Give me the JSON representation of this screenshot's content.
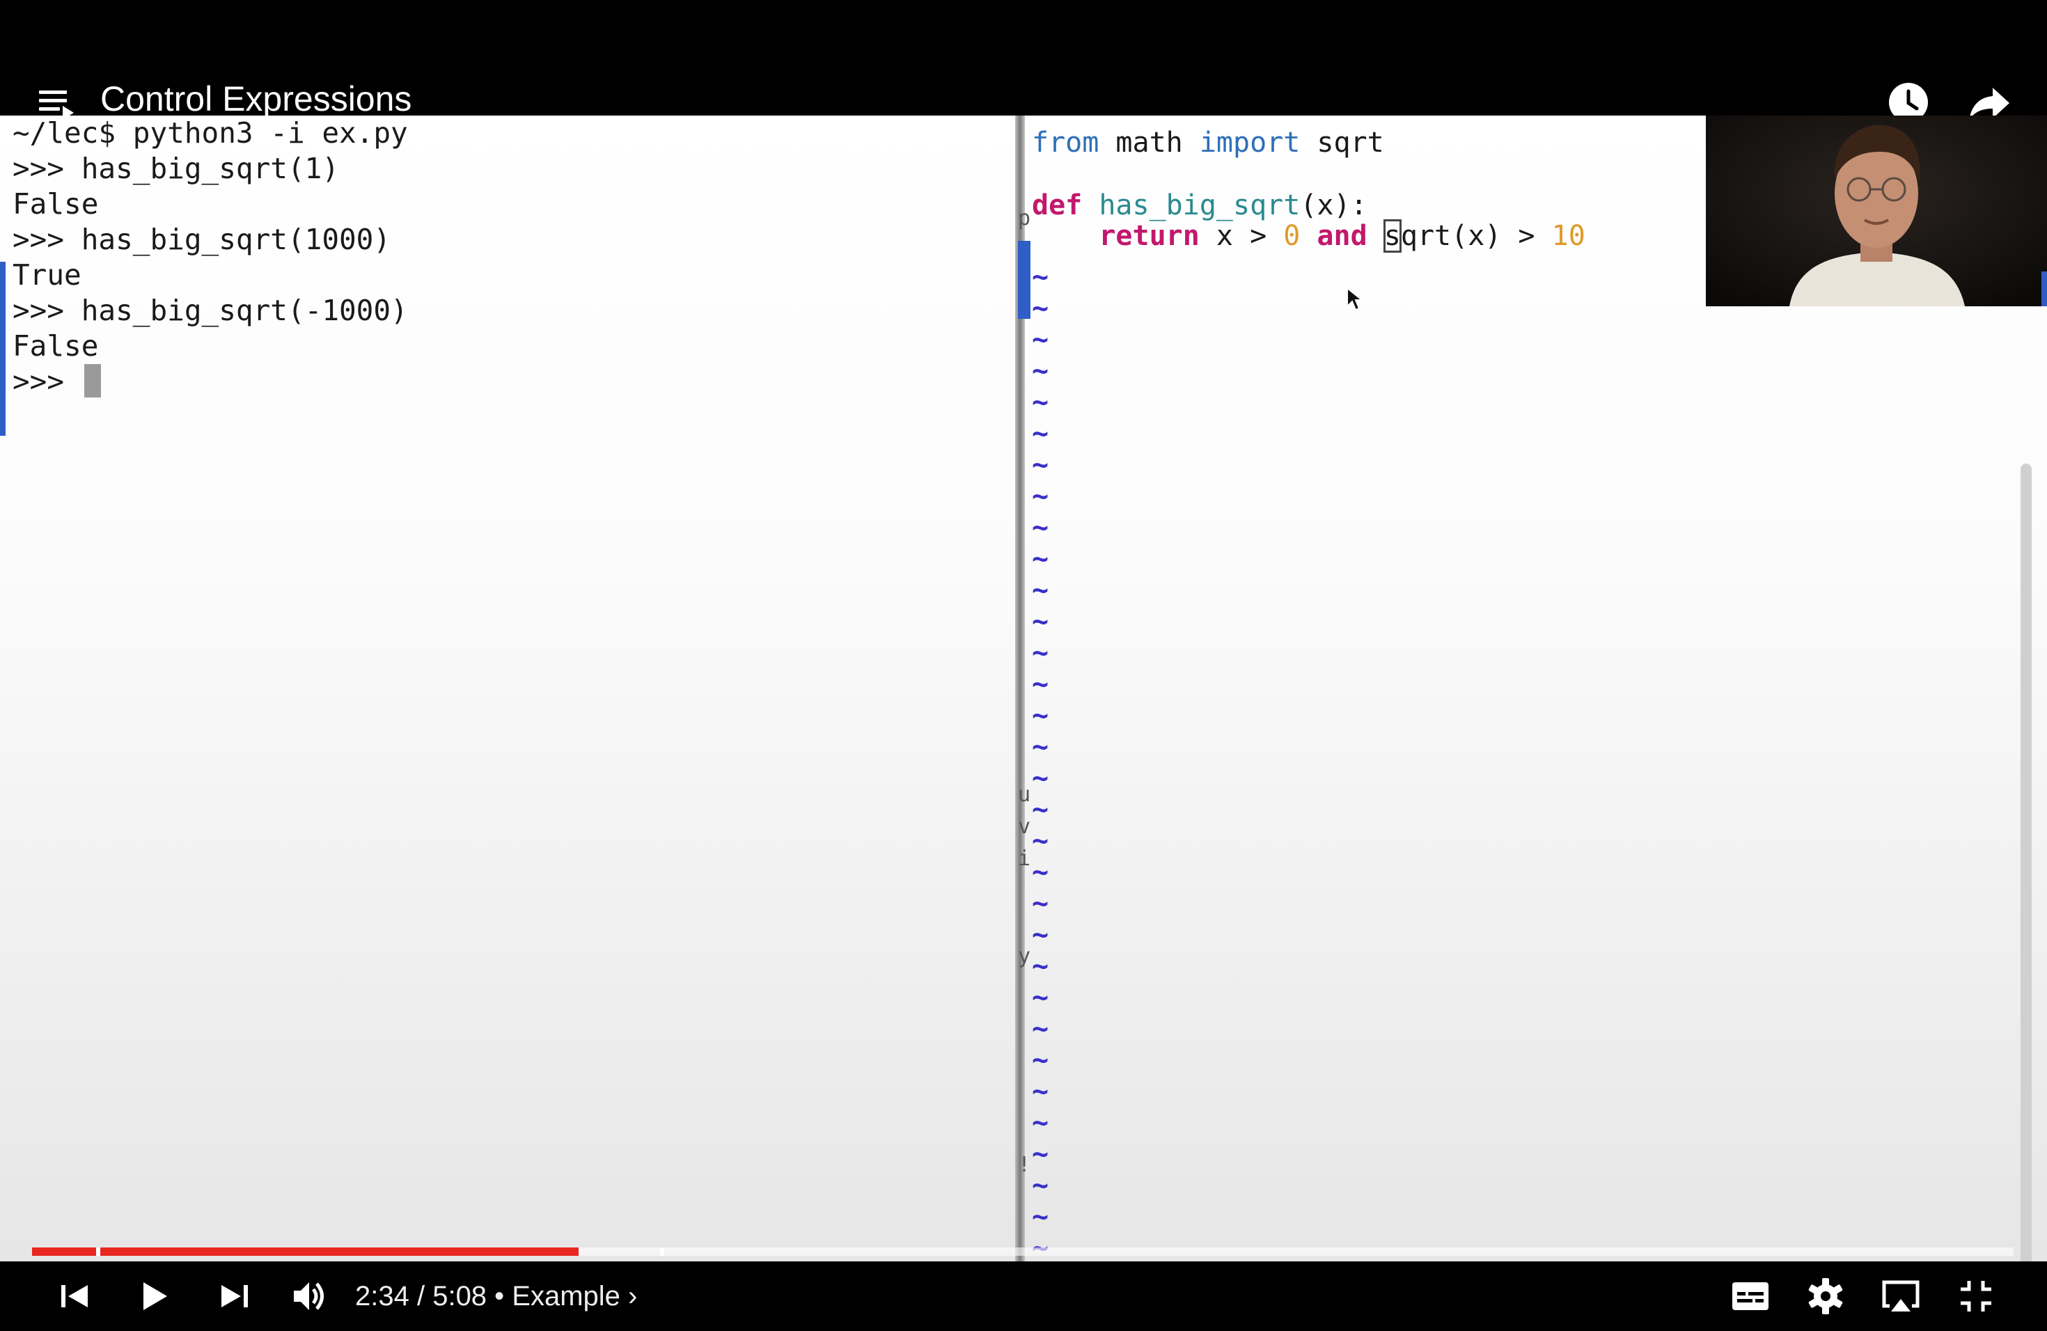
{
  "header": {
    "title": "Control Expressions"
  },
  "terminal": {
    "lines": [
      "~/lec$ python3 -i ex.py",
      ">>> has_big_sqrt(1)",
      "False",
      ">>> has_big_sqrt(1000)",
      "True",
      ">>> has_big_sqrt(-1000)",
      "False",
      ">>> "
    ]
  },
  "editor": {
    "line1": {
      "kw1": "from",
      "mod": " math ",
      "kw2": "import",
      "name": " sqrt"
    },
    "line3": {
      "kw": "def",
      "fn": " has_big_sqrt",
      "rest": "(x):"
    },
    "line4": {
      "indent": "    ",
      "kw1": "return",
      "a": " x > ",
      "n1": "0",
      "kw2": " and ",
      "cursor_char": "s",
      "b": "qrt(x) > ",
      "n2": "10"
    },
    "tilde": "~",
    "stray_chars": [
      "p",
      "u",
      "v",
      "i",
      "y",
      "!"
    ]
  },
  "player": {
    "time_current": "2:34",
    "time_separator": " / ",
    "time_total": "5:08",
    "chapter_separator": " • ",
    "chapter_title": "Example",
    "chapter_chevron": "›",
    "progress_fraction": 0.2757
  },
  "icons": {
    "menu": "playlist-menu-icon",
    "watch_later": "clock-icon",
    "share": "share-arrow-icon",
    "prev": "skip-previous-icon",
    "play": "play-icon",
    "next": "skip-next-icon",
    "volume": "volume-icon",
    "subtitles": "subtitles-icon",
    "settings": "gear-icon",
    "airplay": "airplay-icon",
    "exit_fullscreen": "exit-fullscreen-icon"
  }
}
